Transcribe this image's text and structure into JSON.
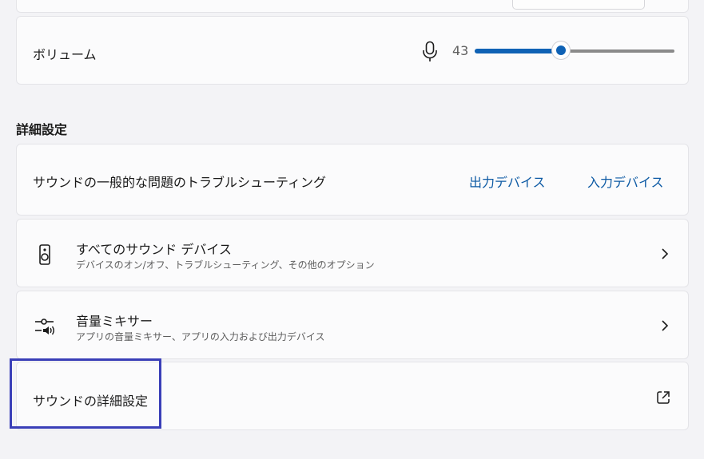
{
  "volume": {
    "label": "ボリューム",
    "value": "43",
    "level": 0.43,
    "mic_icon": "microphone-icon",
    "accent": "#0f62b5"
  },
  "advanced": {
    "heading": "詳細設定",
    "troubleshoot": {
      "label": "サウンドの一般的な問題のトラブルシューティング",
      "output_link": "出力デバイス",
      "input_link": "入力デバイス"
    },
    "all_devices": {
      "icon": "speaker-icon",
      "title": "すべてのサウンド デバイス",
      "subtitle": "デバイスのオン/オフ、トラブルシューティング、その他のオプション"
    },
    "mixer": {
      "icon": "mixer-icon",
      "title": "音量ミキサー",
      "subtitle": "アプリの音量ミキサー、アプリの入力および出力デバイス"
    },
    "more_settings": {
      "label": "サウンドの詳細設定",
      "icon": "external-link-icon"
    }
  },
  "highlight_color": "#3a3fb8"
}
